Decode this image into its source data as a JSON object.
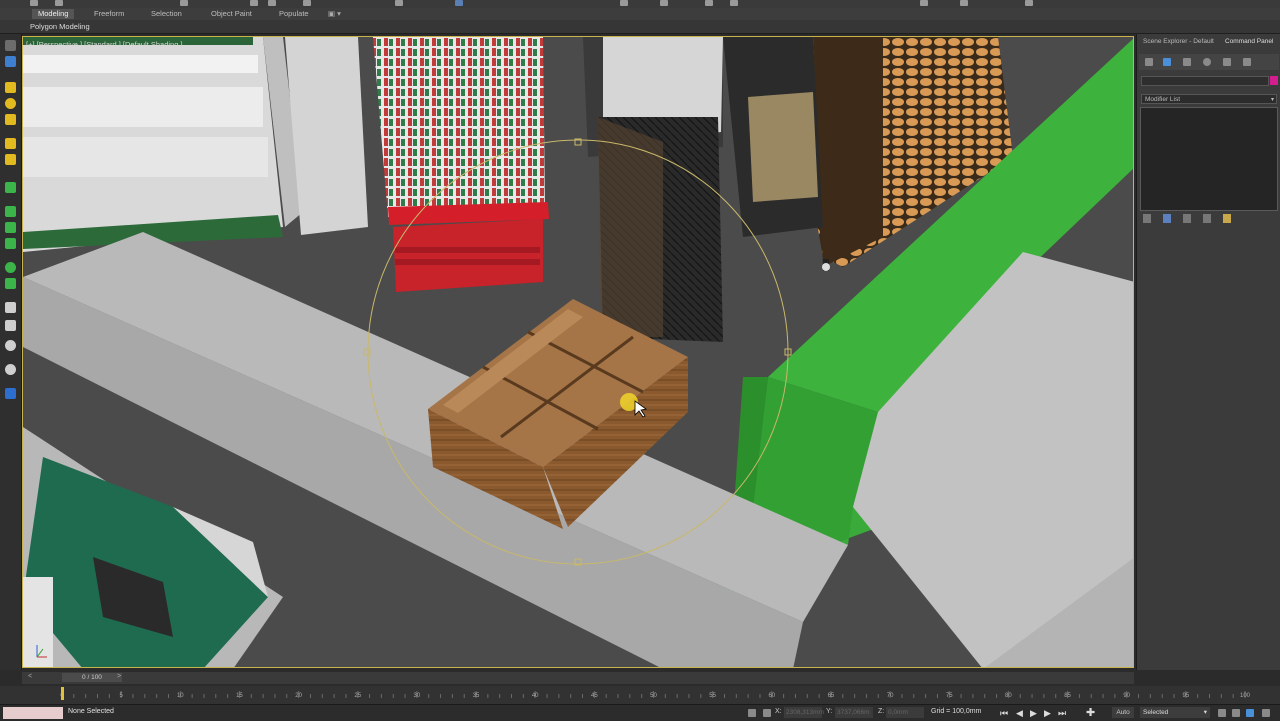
{
  "ribbon": {
    "tabs": [
      {
        "label": "Modeling",
        "active": true
      },
      {
        "label": "Freeform",
        "active": false
      },
      {
        "label": "Selection",
        "active": false
      },
      {
        "label": "Object Paint",
        "active": false
      },
      {
        "label": "Populate",
        "active": false
      }
    ],
    "sub_label": "Polygon Modeling"
  },
  "viewport": {
    "label": "[+] [Perspective ] [Standard ] [Default Shading ]"
  },
  "command_panel": {
    "tabs": [
      "Scene Explorer - Default",
      "Command Panel"
    ],
    "modifier_list_label": "Modifier List",
    "object_color": "#d21e8f"
  },
  "time_slider": {
    "frame_label": "0 / 100",
    "ticks": [
      "0",
      "5",
      "10",
      "15",
      "20",
      "25",
      "30",
      "35",
      "40",
      "45",
      "50",
      "55",
      "60",
      "65",
      "70",
      "75",
      "80",
      "85",
      "90",
      "95",
      "100"
    ]
  },
  "status": {
    "selection_text": "None Selected",
    "x_label": "X:",
    "x_value": "2308,313mm",
    "y_label": "Y:",
    "y_value": "3737,066m",
    "z_label": "Z:",
    "z_value": "0,0mm",
    "grid": "Grid = 100,0mm",
    "auto_key": "Auto",
    "set_key_mode": "Selected"
  },
  "colors": {
    "accent_green": "#3db33d",
    "viewport_border": "#c9b34a",
    "gizmo": "#c8b86a"
  }
}
